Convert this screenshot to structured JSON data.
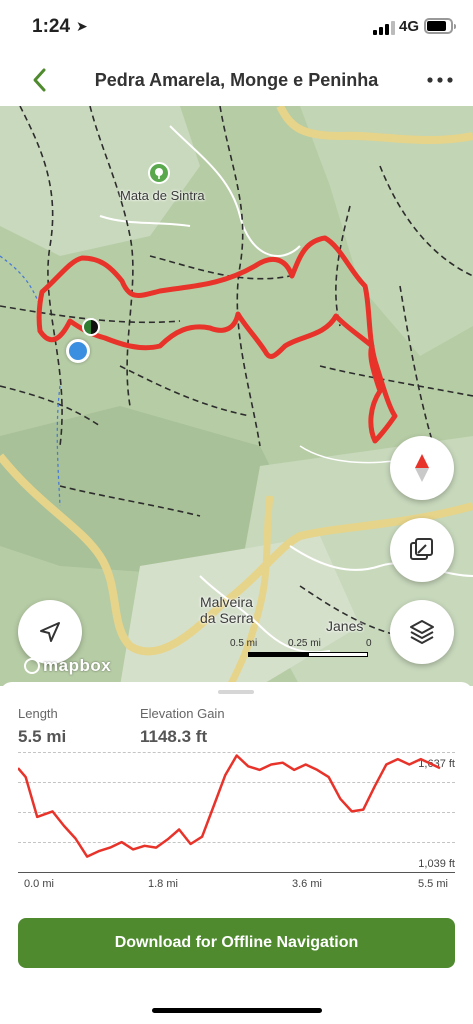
{
  "status_bar": {
    "time": "1:24",
    "network": "4G",
    "signal_bars": 3,
    "battery_level": 0.82
  },
  "header": {
    "title": "Pedra Amarela, Monge e Peninha",
    "back_icon": "chevron-left-icon",
    "more_icon": "more-horizontal-icon"
  },
  "map": {
    "labels": {
      "mata_de_sintra": "Mata de Sintra",
      "malveira": "Malveira\nda Serra",
      "janes": "Janes"
    },
    "scale": {
      "left": "0.5 mi",
      "mid": "0.25 mi",
      "right": "0"
    },
    "attribution": "mapbox",
    "trail_color": "#e8332a",
    "controls": {
      "compass_icon": "compass-icon",
      "photo_icon": "gallery-icon",
      "layers_icon": "layers-icon",
      "locate_icon": "navigation-arrow-icon"
    }
  },
  "stats": {
    "length_label": "Length",
    "length_value": "5.5 mi",
    "elevation_label": "Elevation Gain",
    "elevation_value": "1148.3 ft"
  },
  "chart_data": {
    "type": "line",
    "title": "",
    "xlabel": "",
    "ylabel": "",
    "x_tick_labels": [
      "0.0 mi",
      "1.8 mi",
      "3.6 mi",
      "5.5 mi"
    ],
    "y_tick_labels": [
      "1,637 ft",
      "1,039 ft"
    ],
    "xlim": [
      0,
      5.5
    ],
    "ylim": [
      1039,
      1637
    ],
    "x": [
      0.0,
      0.1,
      0.25,
      0.45,
      0.6,
      0.75,
      0.9,
      1.05,
      1.2,
      1.35,
      1.5,
      1.65,
      1.8,
      1.95,
      2.1,
      2.25,
      2.4,
      2.55,
      2.7,
      2.85,
      3.0,
      3.15,
      3.3,
      3.45,
      3.6,
      3.75,
      3.9,
      4.05,
      4.2,
      4.35,
      4.5,
      4.65,
      4.8,
      4.95,
      5.1,
      5.25,
      5.4,
      5.5
    ],
    "y": [
      1570,
      1520,
      1300,
      1330,
      1250,
      1180,
      1080,
      1110,
      1130,
      1160,
      1120,
      1140,
      1130,
      1175,
      1230,
      1150,
      1190,
      1360,
      1530,
      1640,
      1580,
      1560,
      1590,
      1600,
      1560,
      1590,
      1560,
      1520,
      1400,
      1330,
      1340,
      1470,
      1590,
      1620,
      1590,
      1620,
      1590,
      1570
    ],
    "line_color": "#e8332a",
    "grid": true
  },
  "cta": {
    "label": "Download for Offline Navigation",
    "color": "#4f8a2f"
  }
}
